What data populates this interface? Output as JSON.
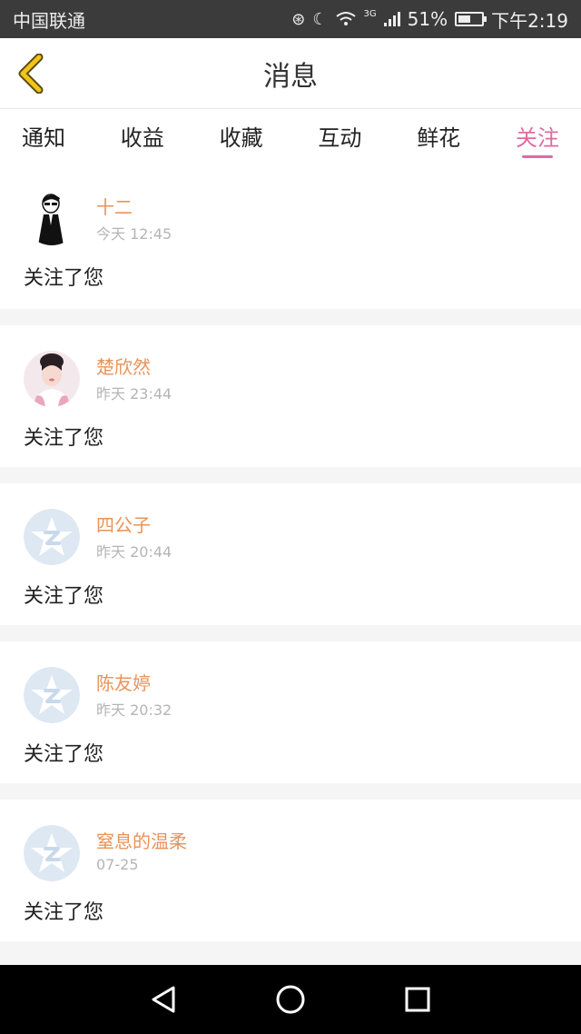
{
  "status_bar": {
    "carrier": "中国联通",
    "network": "3G",
    "battery": "51%",
    "time": "下午2:19"
  },
  "header": {
    "title": "消息"
  },
  "tabs": [
    {
      "label": "通知",
      "active": false
    },
    {
      "label": "收益",
      "active": false
    },
    {
      "label": "收藏",
      "active": false
    },
    {
      "label": "互动",
      "active": false
    },
    {
      "label": "鲜花",
      "active": false
    },
    {
      "label": "关注",
      "active": true
    }
  ],
  "items": [
    {
      "name": "十二",
      "time": "今天 12:45",
      "message": "关注了您",
      "avatar": "cartoon-man-avatar"
    },
    {
      "name": "楚欣然",
      "time": "昨天 23:44",
      "message": "关注了您",
      "avatar": "girl-photo-avatar"
    },
    {
      "name": "四公子",
      "time": "昨天 20:44",
      "message": "关注了您",
      "avatar": "default-star-avatar"
    },
    {
      "name": "陈友婷",
      "time": "昨天 20:32",
      "message": "关注了您",
      "avatar": "default-star-avatar"
    },
    {
      "name": "窒息的温柔",
      "time": "07-25",
      "message": "关注了您",
      "avatar": "default-star-avatar"
    }
  ],
  "colors": {
    "accent": "#e06aa0",
    "name": "#e8935a",
    "back_icon": "#f0c419"
  }
}
